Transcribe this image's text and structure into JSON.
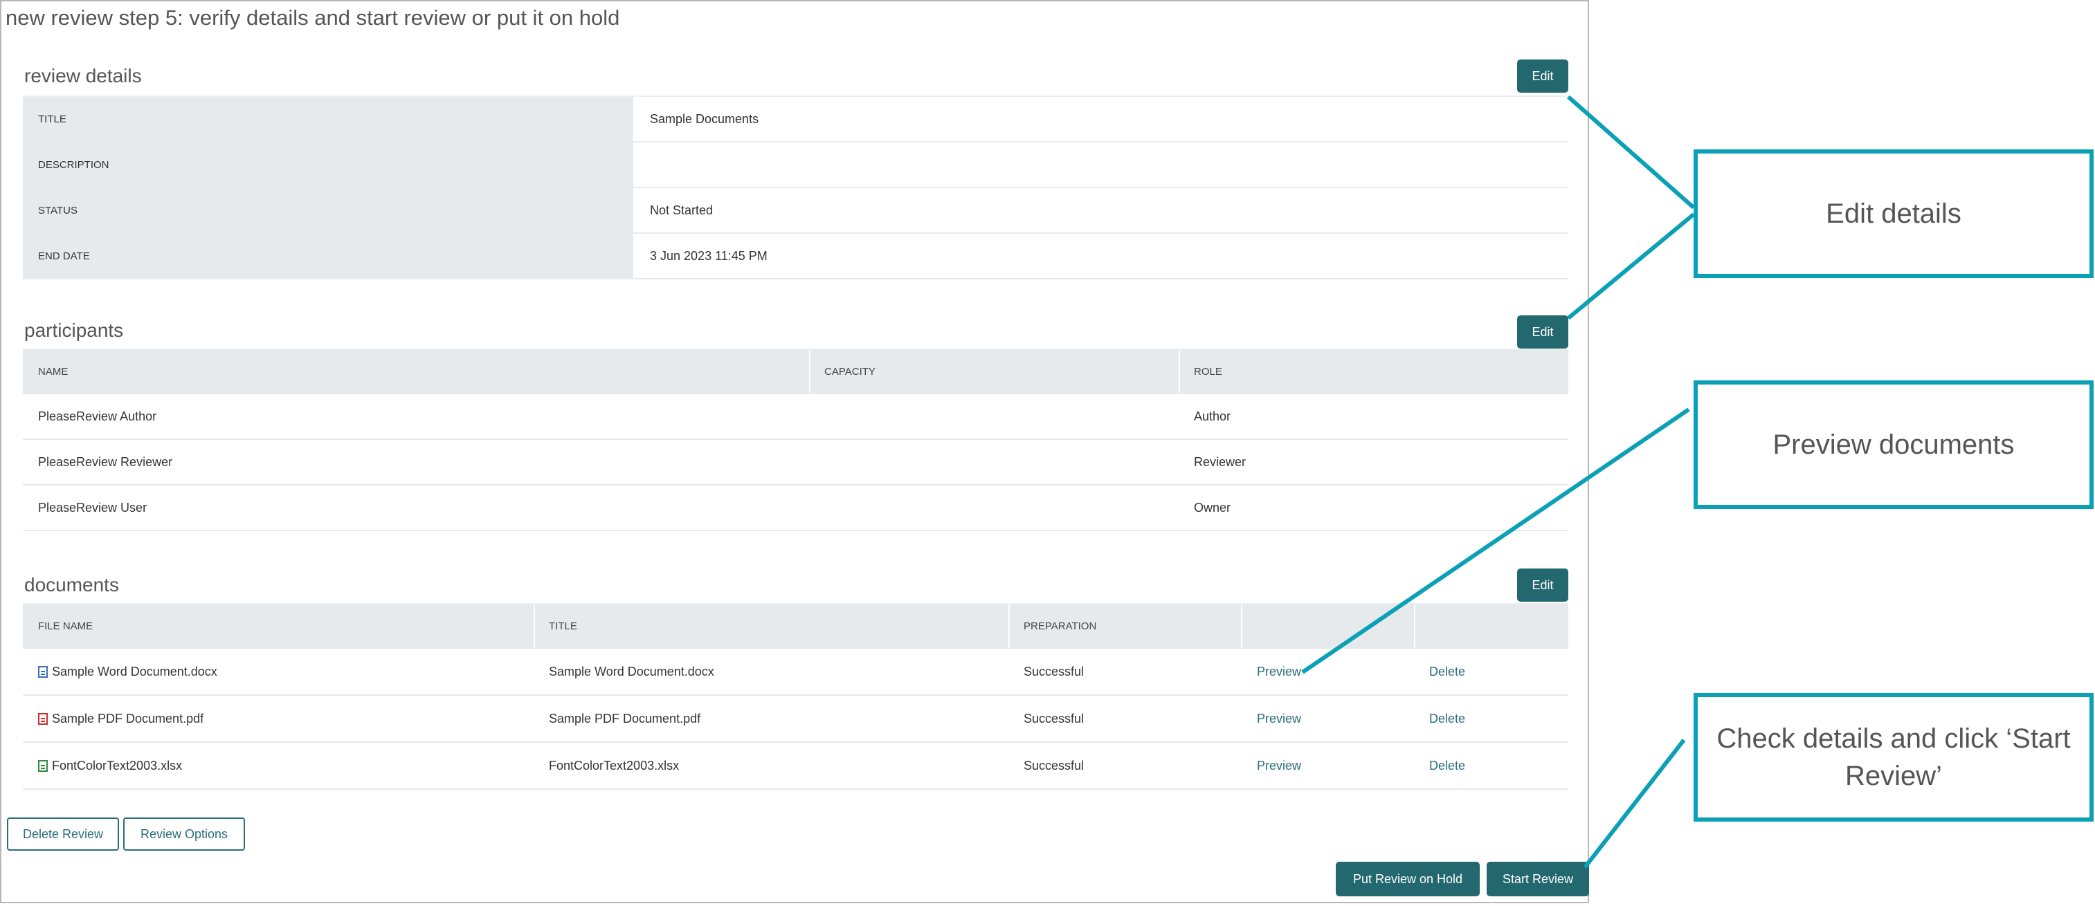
{
  "page_title": "new review step 5: verify details and start review or put it on hold",
  "review_details": {
    "title": "review details",
    "edit_label": "Edit",
    "rows": [
      {
        "label": "TITLE",
        "value": "Sample Documents"
      },
      {
        "label": "DESCRIPTION",
        "value": ""
      },
      {
        "label": "STATUS",
        "value": "Not Started"
      },
      {
        "label": "END DATE",
        "value": "3 Jun 2023 11:45 PM"
      }
    ]
  },
  "participants": {
    "title": "participants",
    "edit_label": "Edit",
    "columns": [
      "NAME",
      "CAPACITY",
      "ROLE"
    ],
    "rows": [
      {
        "name": "PleaseReview Author",
        "capacity": "",
        "role": "Author"
      },
      {
        "name": "PleaseReview Reviewer",
        "capacity": "",
        "role": "Reviewer"
      },
      {
        "name": "PleaseReview User",
        "capacity": "",
        "role": "Owner"
      }
    ]
  },
  "documents": {
    "title": "documents",
    "edit_label": "Edit",
    "columns": [
      "FILE NAME",
      "TITLE",
      "PREPARATION",
      "",
      ""
    ],
    "rows": [
      {
        "file_name": "Sample Word Document.docx",
        "icon": "word-file-icon",
        "title": "Sample Word Document.docx",
        "preparation": "Successful",
        "preview": "Preview",
        "delete": "Delete"
      },
      {
        "file_name": "Sample PDF Document.pdf",
        "icon": "pdf-file-icon",
        "title": "Sample PDF Document.pdf",
        "preparation": "Successful",
        "preview": "Preview",
        "delete": "Delete"
      },
      {
        "file_name": "FontColorText2003.xlsx",
        "icon": "excel-file-icon",
        "title": "FontColorText2003.xlsx",
        "preparation": "Successful",
        "preview": "Preview",
        "delete": "Delete"
      }
    ]
  },
  "actions": {
    "delete_review": "Delete Review",
    "review_options": "Review Options",
    "put_on_hold": "Put Review on Hold",
    "start_review": "Start Review"
  },
  "callouts": {
    "edit_details": "Edit details",
    "preview_documents": "Preview documents",
    "check_details": "Check details and click ‘Start Review’"
  },
  "colors": {
    "accent": "#23676f",
    "header_bg": "#e6eaed",
    "callout_border": "#0aa0b5"
  }
}
